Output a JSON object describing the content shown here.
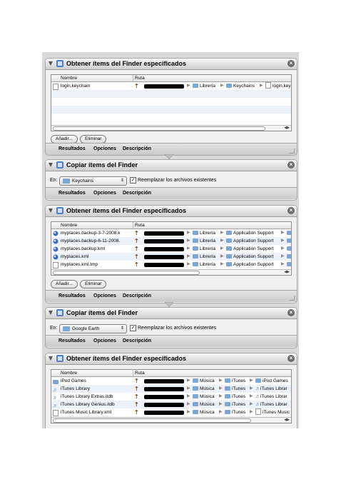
{
  "columns": {
    "name": "Nombre",
    "path": "Ruta"
  },
  "buttons": {
    "add": "Añadir...",
    "remove": "Eliminar"
  },
  "tabs": {
    "results": "Resultados",
    "options": "Opciones",
    "description": "Descripción"
  },
  "copy_labels": {
    "destination": "En:",
    "replace": "Reemplazar los archivos existentes"
  },
  "block1": {
    "title": "Obtener ítems del Finder especificados",
    "rows": [
      {
        "name": "login.keychain",
        "icon": "document-icon",
        "path": [
          "Librería",
          "Keychains",
          "login.key"
        ]
      }
    ]
  },
  "block2": {
    "title": "Copiar ítems del Finder",
    "destination": "Keychains",
    "replace_checked": true
  },
  "block3": {
    "title": "Obtener ítems del Finder especificados",
    "rows": [
      {
        "name": "myplaces.backup-3-7-2008.k",
        "icon": "google-earth-icon",
        "path": [
          "Librería",
          "Application Support",
          ""
        ]
      },
      {
        "name": "myplaces.backup-6-11-2008.",
        "icon": "google-earth-icon",
        "path": [
          "Librería",
          "Application Support",
          ""
        ]
      },
      {
        "name": "myplaces.backup.kml",
        "icon": "google-earth-icon",
        "path": [
          "Librería",
          "Application Support",
          ""
        ]
      },
      {
        "name": "myplaces.kml",
        "icon": "google-earth-icon",
        "path": [
          "Librería",
          "Application Support",
          ""
        ]
      },
      {
        "name": "myplaces.kml.tmp",
        "icon": "document-icon",
        "path": [
          "Librería",
          "Application Support",
          ""
        ]
      }
    ]
  },
  "block4": {
    "title": "Copiar ítems del Finder",
    "destination": "Google Earth",
    "replace_checked": true
  },
  "block5": {
    "title": "Obtener ítems del Finder especificados",
    "rows": [
      {
        "name": "iPod Games",
        "icon": "folder-icon",
        "path": [
          "Música",
          "iTunes",
          "iPod Games"
        ]
      },
      {
        "name": "iTunes Library",
        "icon": "itunes-file-icon",
        "path": [
          "Música",
          "iTunes",
          "iTunes Librar"
        ]
      },
      {
        "name": "iTunes Library Extras.itdb",
        "icon": "itunes-file-icon",
        "path": [
          "Música",
          "iTunes",
          "iTunes Librar"
        ]
      },
      {
        "name": "iTunes Library Genius.itdb",
        "icon": "itunes-file-icon",
        "path": [
          "Música",
          "iTunes",
          "iTunes Librar"
        ]
      },
      {
        "name": "iTunes Music Library.xml",
        "icon": "document-icon",
        "path": [
          "Música",
          "iTunes",
          "iTunes Music"
        ]
      }
    ]
  }
}
